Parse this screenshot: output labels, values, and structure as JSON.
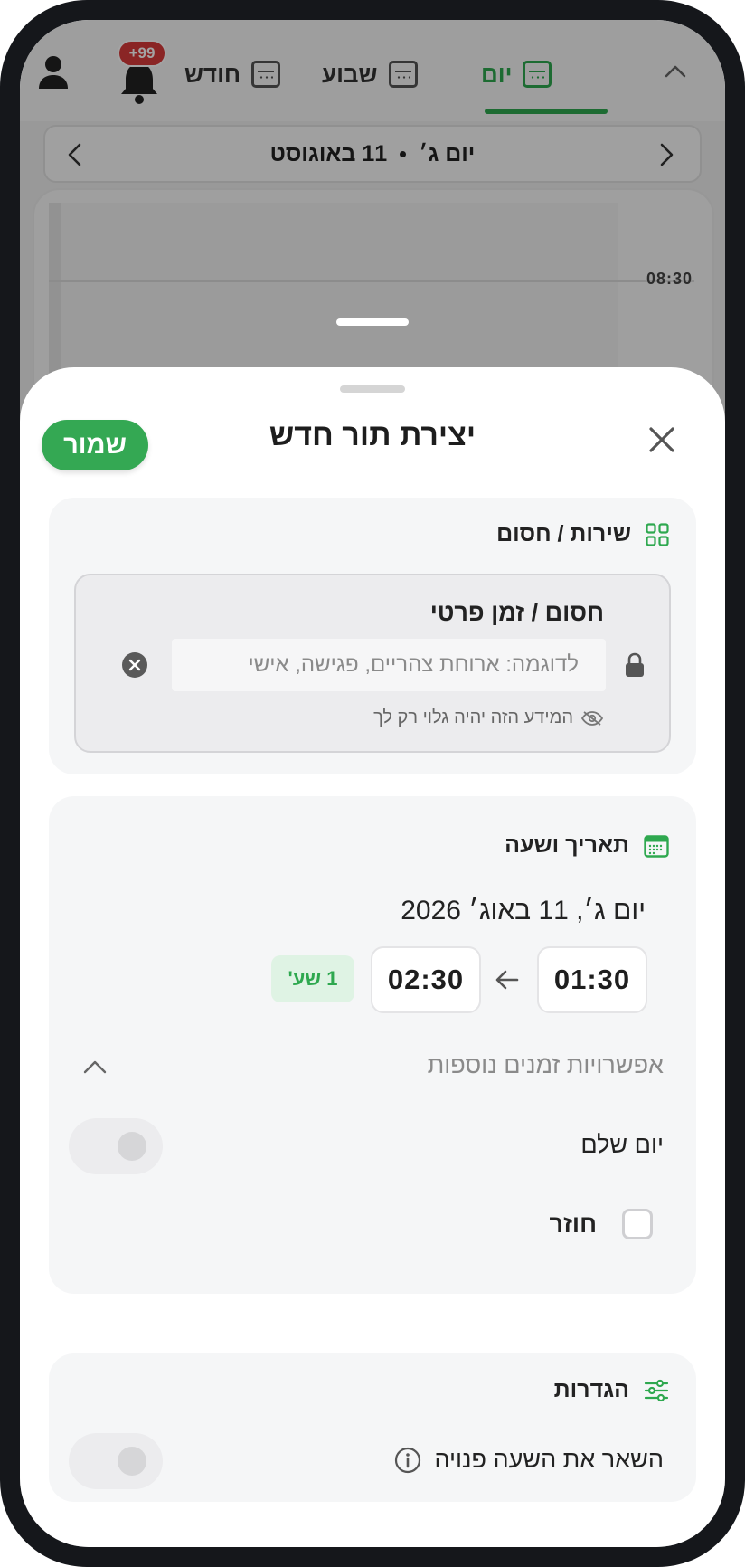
{
  "colors": {
    "accent": "#2ea84f",
    "badge": "#d83a3a",
    "sheet_bg": "#ffffff",
    "card_bg": "#f5f6f7"
  },
  "header": {
    "tabs": [
      {
        "label": "יום",
        "icon": "calendar-icon",
        "active": true
      },
      {
        "label": "שבוע",
        "icon": "calendar-icon",
        "active": false
      },
      {
        "label": "חודש",
        "icon": "calendar-icon",
        "active": false
      }
    ],
    "notifications_badge": "+99"
  },
  "date_nav": {
    "day": "יום ג׳",
    "date": "11 באוגוסט"
  },
  "timeline": {
    "time_label": "08:30"
  },
  "sheet": {
    "title": "יצירת תור חדש",
    "save_label": "שמור"
  },
  "service_card": {
    "heading": "שירות / חסום",
    "block_title": "חסום / זמן פרטי",
    "input_placeholder": "לדוגמה: ארוחת צהריים, פגישה, אישי",
    "privacy_note": "המידע הזה יהיה גלוי רק לך"
  },
  "datetime_card": {
    "heading": "תאריך ושעה",
    "date_text": "יום ג׳, 11 באוג׳ 2026",
    "start_time": "01:30",
    "end_time": "02:30",
    "duration": "1 שע'",
    "more_options": "אפשרויות זמנים נוספות",
    "full_day_label": "יום שלם",
    "full_day_on": false,
    "recurring_label": "חוזר",
    "recurring_checked": false
  },
  "settings_card": {
    "heading": "הגדרות",
    "keep_free_label": "השאר את השעה פנויה",
    "keep_free_on": false
  }
}
